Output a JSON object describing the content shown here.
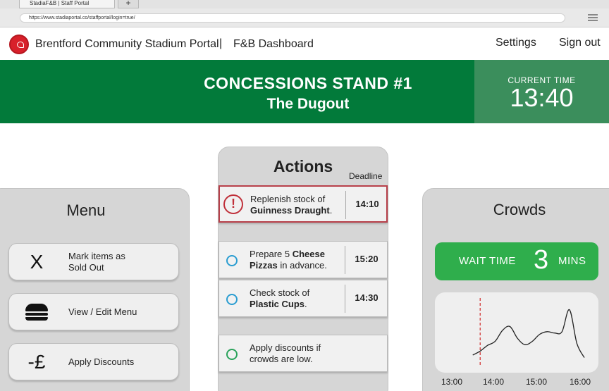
{
  "browser": {
    "tab_title": "StadiaF&B | Staff Portal",
    "new_tab_symbol": "+",
    "url": "https://www.stadiaportal.co/staffportal/login=true/"
  },
  "header": {
    "app_name": "Brentford Community Stadium Portal",
    "separator": "|",
    "dashboard_name": "F&B Dashboard",
    "settings_label": "Settings",
    "signout_label": "Sign out"
  },
  "banner": {
    "stand_title": "CONCESSIONS STAND #1",
    "stand_subtitle": "The Dugout",
    "time_label": "CURRENT TIME",
    "time_value": "13:40"
  },
  "menu": {
    "title": "Menu",
    "items": [
      {
        "icon": "x-icon",
        "glyph": "X",
        "label_line1": "Mark items as",
        "label_line2": "Sold Out"
      },
      {
        "icon": "burger-icon",
        "label_line1": "View / Edit Menu",
        "label_line2": ""
      },
      {
        "icon": "pound-icon",
        "glyph": "-£",
        "label_line1": "Apply Discounts",
        "label_line2": ""
      }
    ]
  },
  "actions": {
    "title": "Actions",
    "deadline_label": "Deadline",
    "items": [
      {
        "status": "urgent",
        "alert_glyph": "!",
        "line1": "Replenish stock of",
        "line2_bold": "Guinness Draught",
        "line2_rest": ".",
        "deadline": "14:10"
      },
      {
        "status": "pending",
        "line1_pre": "Prepare 5 ",
        "line1_bold": "Cheese",
        "line2_bold": "Pizzas",
        "line2_rest": " in advance.",
        "deadline": "15:20"
      },
      {
        "status": "pending",
        "line1": "Check stock of",
        "line2_bold": "Plastic Cups",
        "line2_rest": ".",
        "deadline": "14:30"
      },
      {
        "status": "optional",
        "line1": "Apply discounts if",
        "line2": "crowds are low."
      }
    ]
  },
  "crowds": {
    "title": "Crowds",
    "wait_label": "WAIT TIME",
    "wait_value": "3",
    "wait_unit": "MINS",
    "accent_color": "#2fae4c"
  },
  "chart_data": {
    "type": "line",
    "x_ticks": [
      "13:00",
      "14:00",
      "15:00",
      "16:00"
    ],
    "current_time_marker": "13:40",
    "series": [
      {
        "x": [
          "13:30",
          "13:40",
          "13:50",
          "14:00",
          "14:10",
          "14:20",
          "14:30",
          "14:40",
          "14:50",
          "15:00",
          "15:10",
          "15:20",
          "15:30",
          "15:40",
          "15:50",
          "16:00"
        ],
        "values": [
          0.12,
          0.18,
          0.27,
          0.33,
          0.5,
          0.56,
          0.38,
          0.28,
          0.33,
          0.44,
          0.48,
          0.46,
          0.48,
          0.82,
          0.3,
          0.08
        ]
      }
    ]
  }
}
